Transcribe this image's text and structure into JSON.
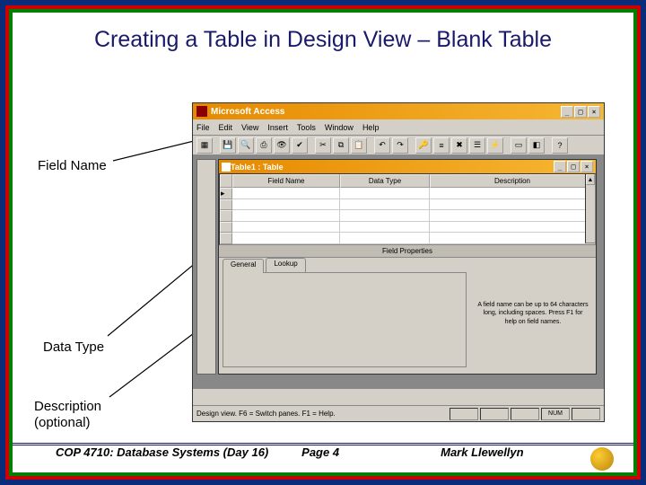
{
  "slide": {
    "title": "Creating a Table in Design View – Blank Table",
    "labels": {
      "field_name": "Field Name",
      "data_type": "Data Type",
      "description": "Description\n(optional)"
    },
    "footer": {
      "left": "COP 4710: Database Systems (Day 16)",
      "mid": "Page 4",
      "right": "Mark Llewellyn"
    }
  },
  "access": {
    "app_title": "Microsoft Access",
    "menu": [
      "File",
      "Edit",
      "View",
      "Insert",
      "Tools",
      "Window",
      "Help"
    ],
    "toolbar_icons": [
      "view",
      "save",
      "search",
      "print",
      "preview",
      "spell",
      "cut",
      "copy",
      "paste",
      "undo",
      "redo",
      "key",
      "row-ins",
      "row-del",
      "props",
      "build",
      "db",
      "code",
      "help"
    ],
    "sub_title": "Table1 : Table",
    "columns": {
      "field_name": "Field Name",
      "data_type": "Data Type",
      "description": "Description"
    },
    "props_section_label": "Field Properties",
    "tabs": {
      "general": "General",
      "lookup": "Lookup"
    },
    "help_text": "A field name can be up to 64 characters long, including spaces. Press F1 for help on field names.",
    "statusbar": {
      "text": "Design view.  F6 = Switch panes.  F1 = Help.",
      "num": "NUM"
    },
    "window_buttons": {
      "min": "_",
      "max": "□",
      "close": "×"
    }
  }
}
